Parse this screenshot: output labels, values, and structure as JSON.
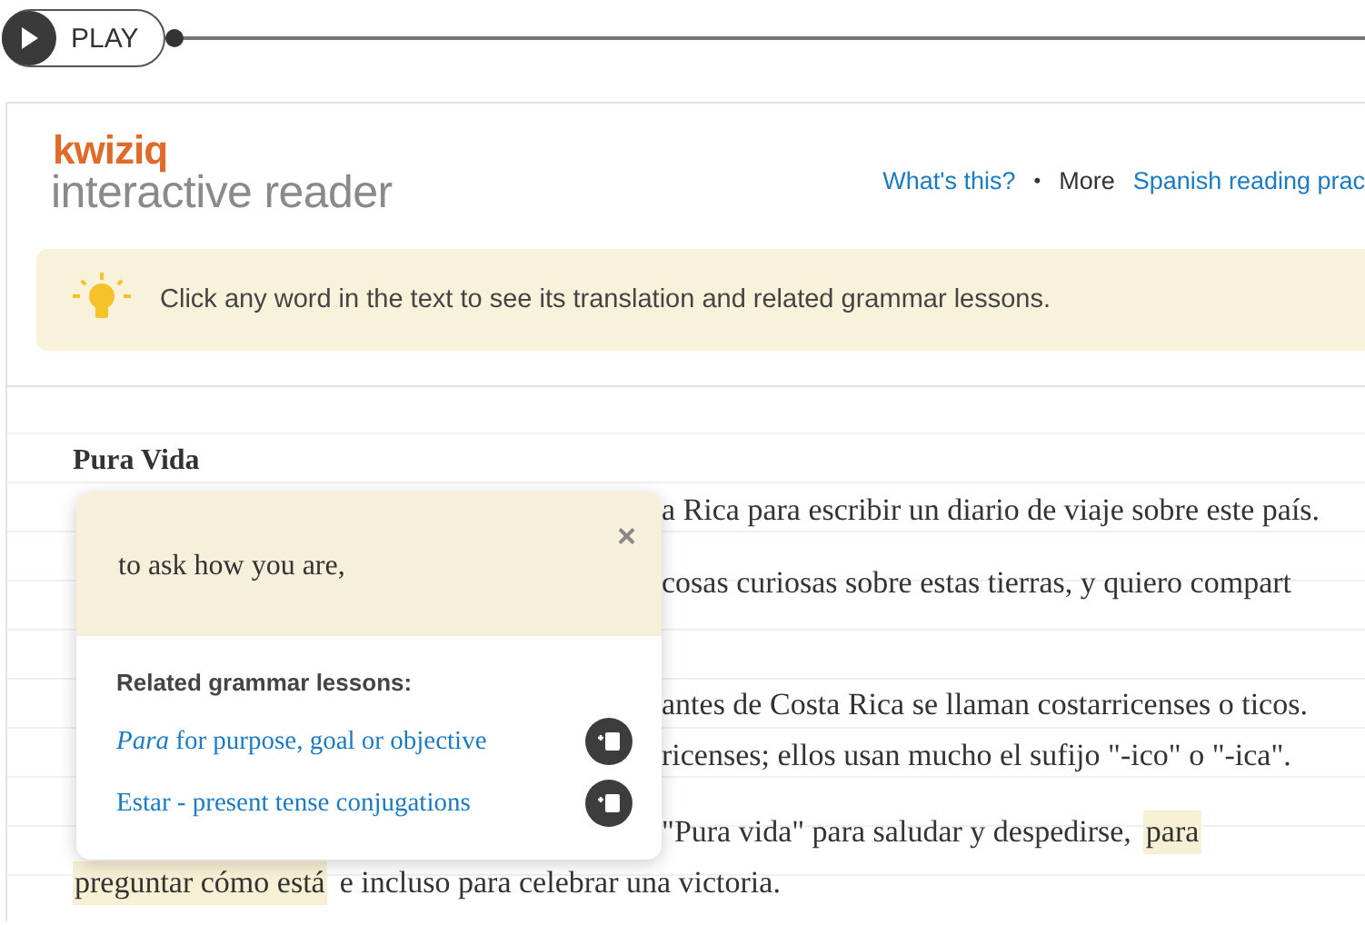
{
  "player": {
    "label": "PLAY",
    "level": 0
  },
  "header": {
    "logo": "kwiziq",
    "subtitle": "interactive reader",
    "links": [
      {
        "kind": "link",
        "text": "What's this?"
      },
      {
        "kind": "separator",
        "text": "•"
      },
      {
        "kind": "plain",
        "text": "More"
      },
      {
        "kind": "link",
        "text": "Spanish reading prac"
      }
    ]
  },
  "tip": {
    "text": "Click any word in the text to see its translation and related grammar lessons."
  },
  "story": {
    "title": "Pura Vida",
    "paragraphs": [
      {
        "lines": [
          {
            "covered": true,
            "segments": [
              {
                "text": "a Rica  para escribir un diario de viaje  sobre este país.",
                "highlighted": false
              }
            ]
          },
          {
            "covered": true,
            "segments": [
              {
                "text": "cosas curiosas  sobre estas tierras,  y quiero compart",
                "highlighted": false
              }
            ]
          }
        ]
      },
      {
        "lines": [
          {
            "covered": true,
            "segments": [
              {
                "text": "antes de Costa Rica  se llaman costarricenses o ticos.",
                "highlighted": false
              }
            ]
          },
          {
            "covered": true,
            "segments": [
              {
                "text": "ricenses;  ellos usan mucho el sufijo \"-ico\" o \"-ica\".",
                "highlighted": false
              }
            ]
          }
        ]
      },
      {
        "lines": [
          {
            "covered": true,
            "segments": [
              {
                "text": "\"Pura vida\"  para saludar y despedirse,",
                "highlighted": false
              },
              {
                "text": "para",
                "highlighted": true
              }
            ]
          },
          {
            "covered": false,
            "segments": [
              {
                "text": "preguntar cómo está",
                "highlighted": true
              },
              {
                "text": "e incluso para celebrar una victoria.",
                "highlighted": false
              }
            ]
          }
        ]
      }
    ]
  },
  "popup": {
    "translation": "to ask how you are,",
    "close": "×",
    "lessons_heading": "Related grammar lessons:",
    "lessons": [
      {
        "title": "*Para* for purpose, goal or objective"
      },
      {
        "title": "Estar - present tense conjugations"
      }
    ]
  }
}
